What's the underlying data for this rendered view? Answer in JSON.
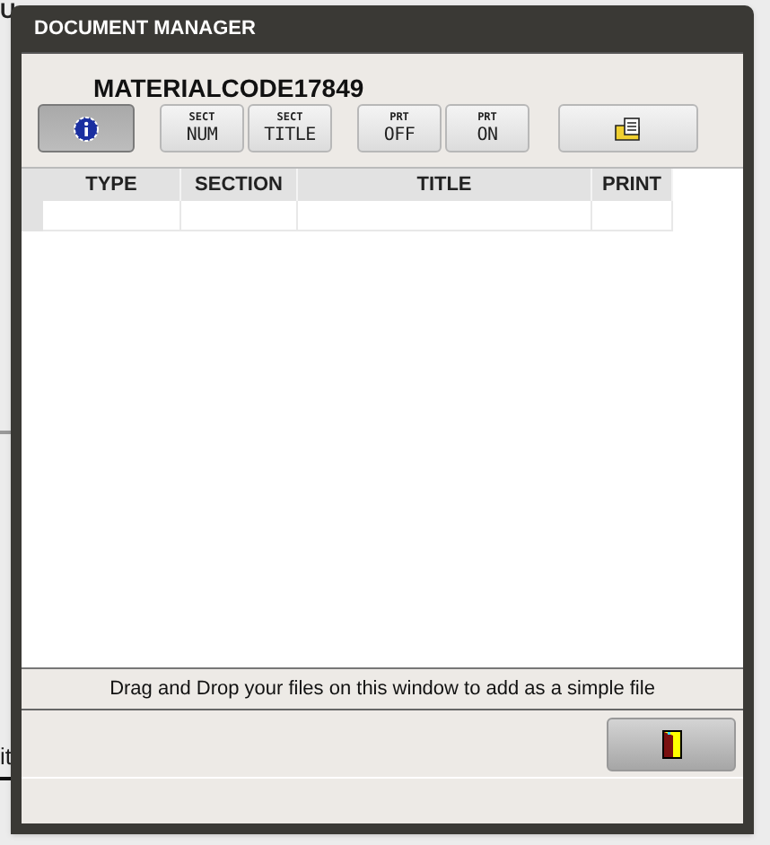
{
  "background_text": [
    "U",
    "it"
  ],
  "window": {
    "title": "DOCUMENT MANAGER"
  },
  "material_code": "MATERIALCODE17849",
  "toolbar": [
    {
      "kind": "info",
      "selected": true
    },
    {
      "kind": "text",
      "small": "SECT",
      "label": "NUM",
      "selected": false
    },
    {
      "kind": "text",
      "small": "SECT",
      "label": "TITLE",
      "selected": false
    },
    {
      "kind": "text",
      "small": "PRT",
      "label": "OFF",
      "selected": false
    },
    {
      "kind": "text",
      "small": "PRT",
      "label": "ON",
      "selected": false
    },
    {
      "kind": "folder",
      "selected": false
    }
  ],
  "table": {
    "columns": [
      "TYPE",
      "SECTION",
      "TITLE",
      "PRINT"
    ]
  },
  "drop_hint": "Drag and Drop your files on this window to add as a simple file"
}
